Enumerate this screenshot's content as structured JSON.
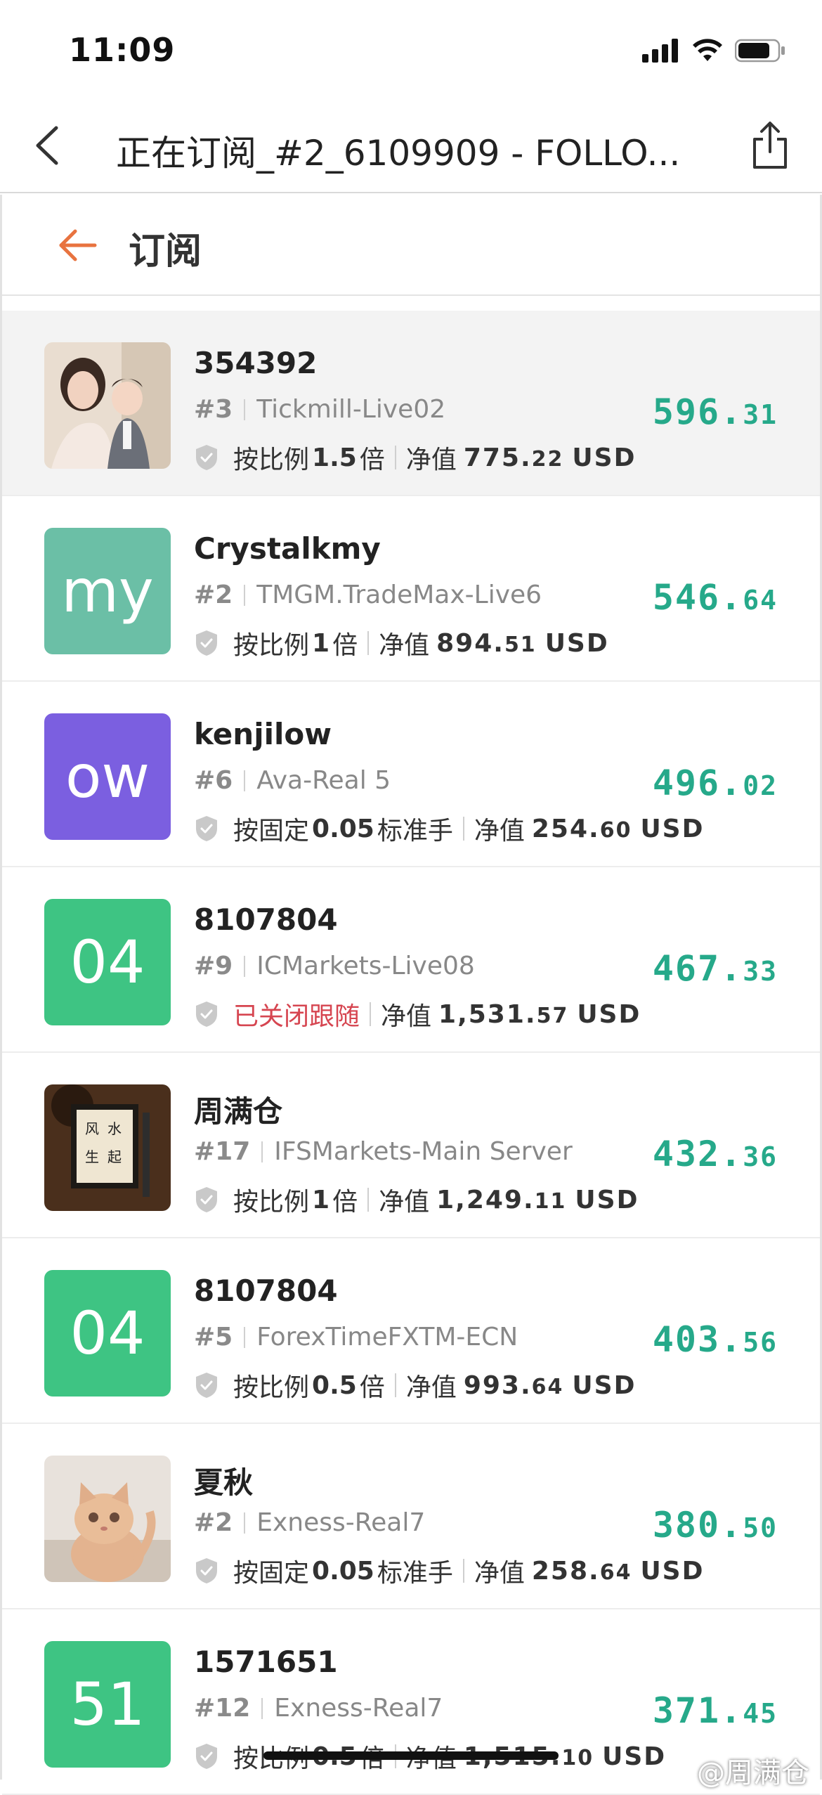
{
  "status_bar": {
    "time": "11:09"
  },
  "nav": {
    "title": "正在订阅_#2_6109909 - FOLLO..."
  },
  "sub_header": {
    "title": "订阅"
  },
  "colors": {
    "accent_orange": "#e8733f",
    "profit_green": "#26a98a",
    "closed_red": "#d64550"
  },
  "rows": [
    {
      "avatar_type": "photo",
      "avatar_desc": "woman-and-baby-photo",
      "name": "354392",
      "rank": "#3",
      "server": "Tickmill-Live02",
      "mode_prefix": "按比例",
      "mode_value": "1.5",
      "mode_suffix": "倍",
      "equity_label": "净值",
      "equity_int": "775.",
      "equity_dec": "22",
      "currency": "USD",
      "profit_int": "596.",
      "profit_dec": "31",
      "highlighted": true
    },
    {
      "avatar_type": "text",
      "avatar_text": "my",
      "avatar_color": "#6bbfa6",
      "name": "Crystalkmy",
      "rank": "#2",
      "server": "TMGM.TradeMax-Live6",
      "mode_prefix": "按比例",
      "mode_value": "1",
      "mode_suffix": "倍",
      "equity_label": "净值",
      "equity_int": "894.",
      "equity_dec": "51",
      "currency": "USD",
      "profit_int": "546.",
      "profit_dec": "64"
    },
    {
      "avatar_type": "text",
      "avatar_text": "ow",
      "avatar_color": "#7b5fe0",
      "name": "kenjilow",
      "rank": "#6",
      "server": "Ava-Real 5",
      "mode_prefix": "按固定",
      "mode_value": "0.05",
      "mode_suffix": "标准手",
      "equity_label": "净值",
      "equity_int": "254.",
      "equity_dec": "60",
      "currency": "USD",
      "profit_int": "496.",
      "profit_dec": "02"
    },
    {
      "avatar_type": "text",
      "avatar_text": "04",
      "avatar_color": "#3ec483",
      "name": "8107804",
      "rank": "#9",
      "server": "ICMarkets-Live08",
      "closed_text": "已关闭跟随",
      "equity_label": "净值",
      "equity_int": "1,531.",
      "equity_dec": "57",
      "currency": "USD",
      "profit_int": "467.",
      "profit_dec": "33"
    },
    {
      "avatar_type": "photo",
      "avatar_desc": "calligraphy-frame-photo",
      "name": "周满仓",
      "rank": "#17",
      "server": "IFSMarkets-Main Server",
      "mode_prefix": "按比例",
      "mode_value": "1",
      "mode_suffix": "倍",
      "equity_label": "净值",
      "equity_int": "1,249.",
      "equity_dec": "11",
      "currency": "USD",
      "profit_int": "432.",
      "profit_dec": "36"
    },
    {
      "avatar_type": "text",
      "avatar_text": "04",
      "avatar_color": "#3ec483",
      "name": "8107804",
      "rank": "#5",
      "server": "ForexTimeFXTM-ECN",
      "mode_prefix": "按比例",
      "mode_value": "0.5",
      "mode_suffix": "倍",
      "equity_label": "净值",
      "equity_int": "993.",
      "equity_dec": "64",
      "currency": "USD",
      "profit_int": "403.",
      "profit_dec": "56"
    },
    {
      "avatar_type": "photo",
      "avatar_desc": "kitten-photo",
      "name": "夏秋",
      "rank": "#2",
      "server": "Exness-Real7",
      "mode_prefix": "按固定",
      "mode_value": "0.05",
      "mode_suffix": "标准手",
      "equity_label": "净值",
      "equity_int": "258.",
      "equity_dec": "64",
      "currency": "USD",
      "profit_int": "380.",
      "profit_dec": "50"
    },
    {
      "avatar_type": "text",
      "avatar_text": "51",
      "avatar_color": "#3ec483",
      "name": "1571651",
      "rank": "#12",
      "server": "Exness-Real7",
      "mode_prefix": "按比例",
      "mode_value": "0.5",
      "mode_suffix": "倍",
      "equity_label": "净值",
      "equity_int": "1,515.",
      "equity_dec": "10",
      "currency": "USD",
      "profit_int": "371.",
      "profit_dec": "45"
    }
  ],
  "watermark": "@周满仓"
}
